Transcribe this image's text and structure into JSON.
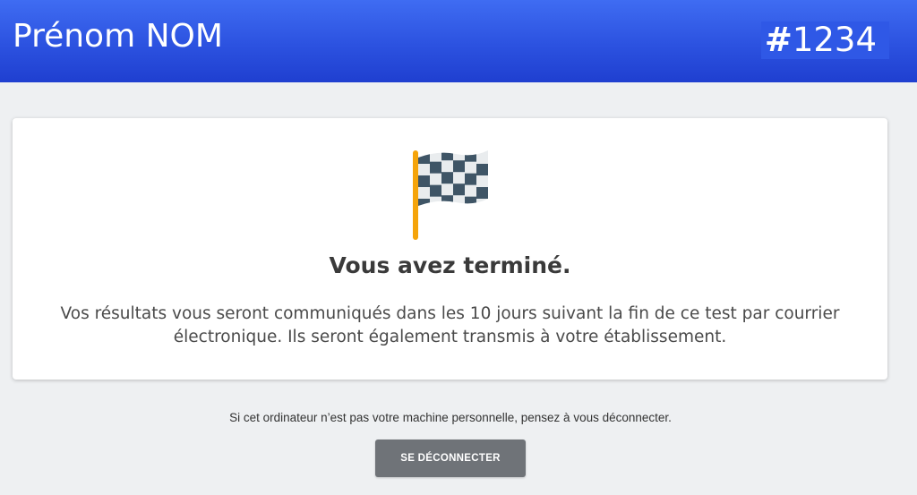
{
  "header": {
    "user_name": "Prénom NOM",
    "candidate_id_hash": "#",
    "candidate_id_number": "1234"
  },
  "card": {
    "icon": "checkered-flag-icon",
    "title": "Vous avez terminé.",
    "message_line1": "Vos résultats vous seront communiqués dans les 10 jours suivant la fin de ce test par courrier",
    "message_line2": "électronique. Ils seront également transmis à votre établissement."
  },
  "footer": {
    "notice": "Si cet ordinateur n’est pas votre machine personnelle, pensez à vous déconnecter.",
    "logout_label": "SE DÉCONNECTER"
  },
  "colors": {
    "header_blue": "#2c52e0",
    "page_background": "#eef0f2",
    "button_gray": "#6f7378",
    "flag_pole": "#f5a40a",
    "flag_dark": "#3f5566"
  }
}
